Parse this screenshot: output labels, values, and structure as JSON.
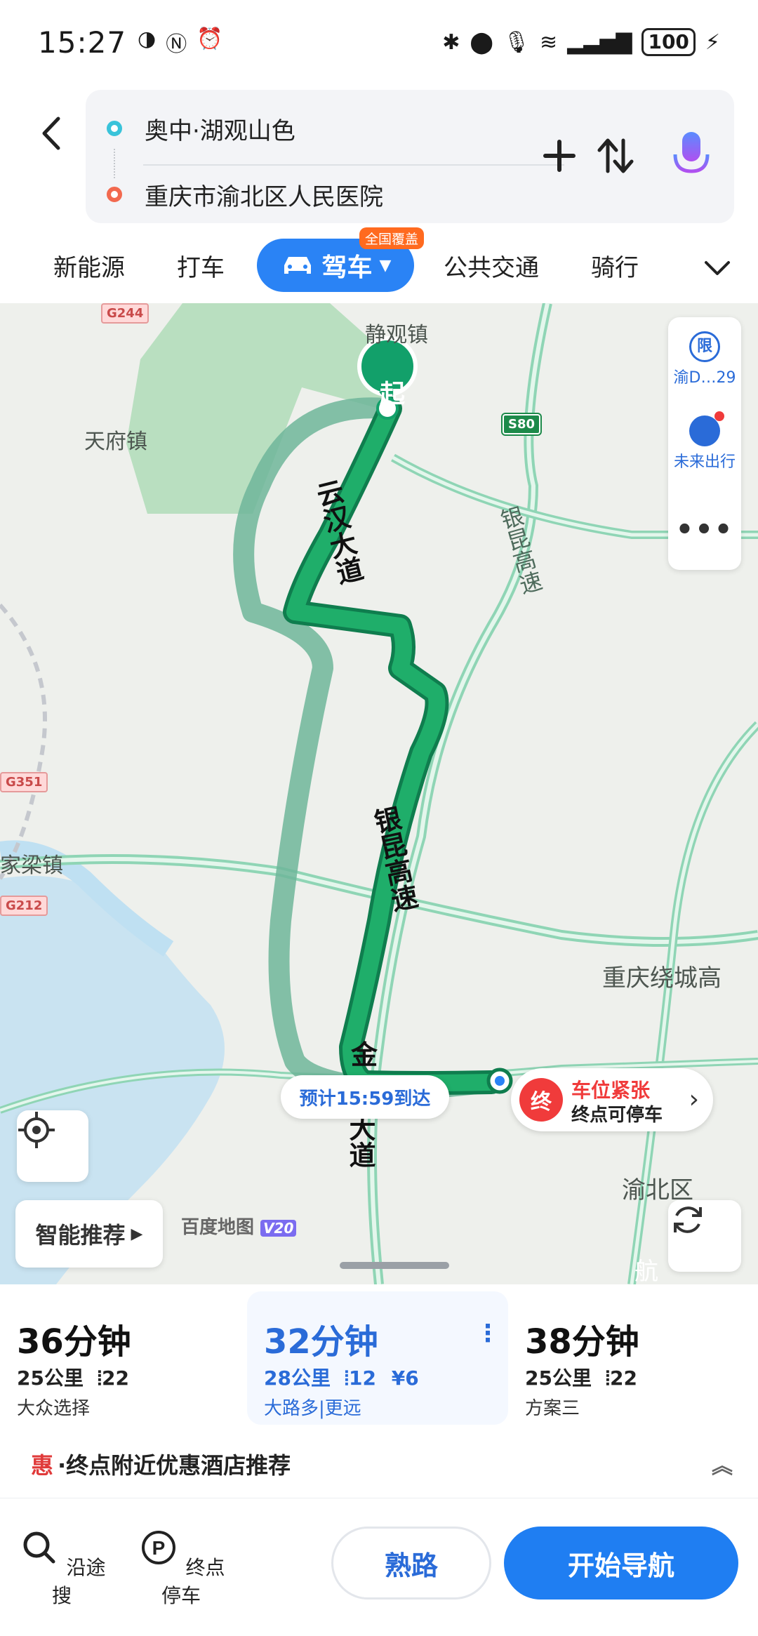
{
  "status_bar": {
    "time": "15:27",
    "battery": "100"
  },
  "route_input": {
    "start": "奥中·湖观山色",
    "end": "重庆市渝北区人民医院"
  },
  "tabs": {
    "items": [
      "新能源",
      "打车",
      "驾车",
      "公共交通",
      "骑行"
    ],
    "drive_badge": "全国覆盖"
  },
  "map": {
    "labels": [
      "静观镇",
      "天府镇",
      "家梁镇",
      "渝北区",
      "重庆绕城高",
      "航"
    ],
    "road_names": [
      "云汉大道",
      "银昆高速",
      "金",
      "大道",
      "银昆高速"
    ],
    "shields": [
      "G244",
      "S80",
      "G351",
      "G212"
    ],
    "start_marker": "起",
    "side_panel": {
      "limit_label": "渝D…29",
      "limit_icon_text": "限",
      "future_label": "未来出行"
    },
    "eta": "预计15:59到达",
    "destination": {
      "marker": "终",
      "line1": "车位紧张",
      "line2": "终点可停车"
    },
    "smart_recommend": "智能推荐",
    "logo_text": "百度地图",
    "logo_version": "V20"
  },
  "routes": [
    {
      "duration": "36分钟",
      "distance": "25公里",
      "lights": "22",
      "tag": "大众选择"
    },
    {
      "duration": "32分钟",
      "distance": "28公里",
      "lights": "12",
      "toll": "¥6",
      "tag": "大路多|更远"
    },
    {
      "duration": "38分钟",
      "distance": "25公里",
      "lights": "22",
      "tag": "方案三"
    }
  ],
  "promo": {
    "icon_text": "惠",
    "text": "·终点附近优惠酒店推荐"
  },
  "bottom_bar": {
    "search_along": "沿途搜",
    "dest_parking": "终点停车",
    "familiar_route": "熟路",
    "start_nav": "开始导航"
  },
  "colors": {
    "primary": "#2a83f5",
    "route_active": "#1fae6a",
    "route_alt": "#8fc7b0",
    "destination_red": "#f03b3b"
  }
}
